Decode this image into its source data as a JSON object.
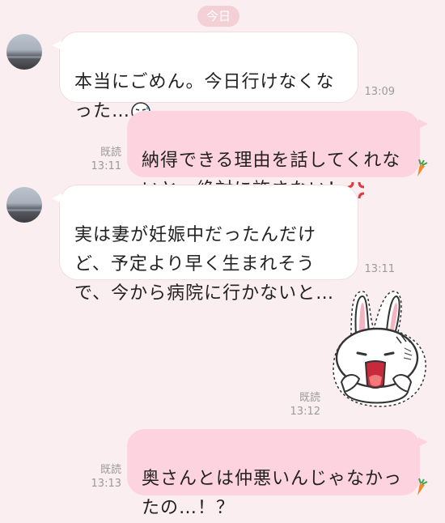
{
  "date_label": "今日",
  "messages": [
    {
      "side": "in",
      "text": "本当にごめん。今日行けなくな\nった…",
      "emoji": "sweat-face-emoji",
      "time": "13:09"
    },
    {
      "side": "out",
      "text": "納得できる理由を話してくれな\nいと、絶対に許さない！",
      "emoji": "anger-symbol-emoji",
      "read": "既読",
      "time": "13:11"
    },
    {
      "side": "in",
      "text": "実は妻が妊娠中だったんだけ\nど、予定より早く生まれそう\nで、今から病院に行かないと…",
      "time": "13:11"
    },
    {
      "side": "out",
      "type": "sticker",
      "sticker": "shocked-rabbit-sticker",
      "read": "既読",
      "time": "13:12"
    },
    {
      "side": "out",
      "text": "奥さんとは仲悪いんじゃなかっ\nたの…！？",
      "read": "既読",
      "time": "13:13"
    }
  ],
  "colors": {
    "background": "#fbeef1",
    "outgoing_bubble": "#fdd3df",
    "incoming_bubble": "#ffffff",
    "date_pill": "#f3cfd6"
  }
}
